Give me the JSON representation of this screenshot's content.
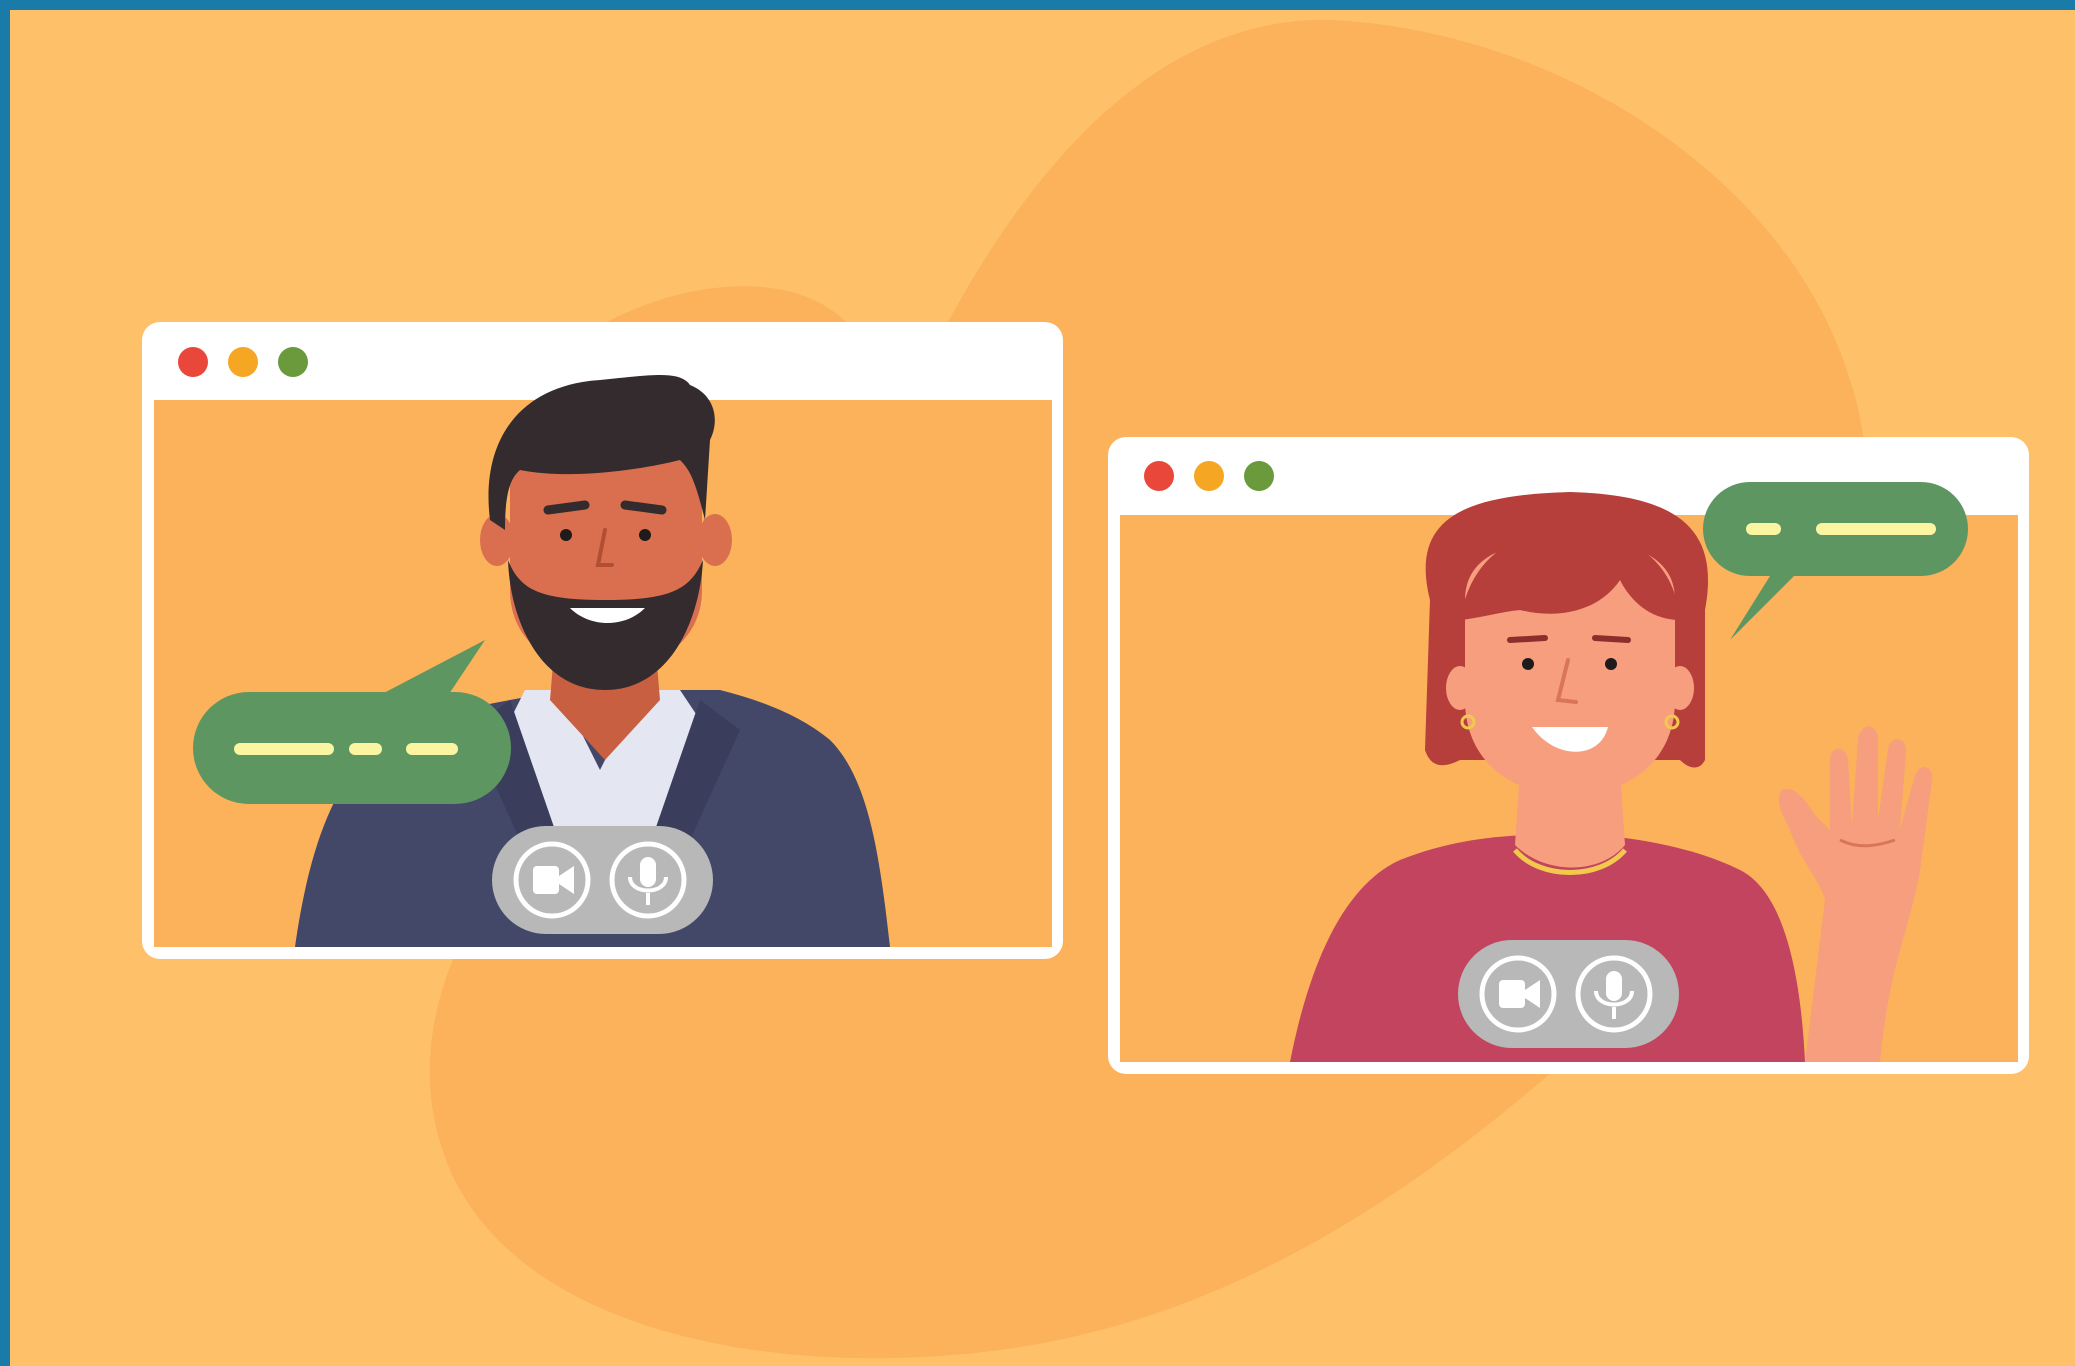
{
  "colors": {
    "frame": "#1a7aa8",
    "background": "#fec16a",
    "blob": "#fbb25b",
    "window": "#ffffff",
    "window_inner": "#fbb25b",
    "dot_red": "#e8473a",
    "dot_yellow": "#f5a623",
    "dot_green": "#6a9a3c",
    "bubble": "#5e9661",
    "bubble_lines": "#fbf5a2",
    "control_pill": "#b8b8b8",
    "man_jacket": "#434768",
    "man_skin": "#d96f4f",
    "man_hair": "#332b2e",
    "woman_hair": "#b63e3b",
    "woman_top": "#c2445e",
    "woman_skin": "#f69e7e"
  },
  "windows": [
    {
      "name": "left-call-window",
      "controls": [
        "camera-icon",
        "microphone-icon"
      ],
      "person": "man-with-beard"
    },
    {
      "name": "right-call-window",
      "controls": [
        "camera-icon",
        "microphone-icon"
      ],
      "person": "woman-waving"
    }
  ]
}
